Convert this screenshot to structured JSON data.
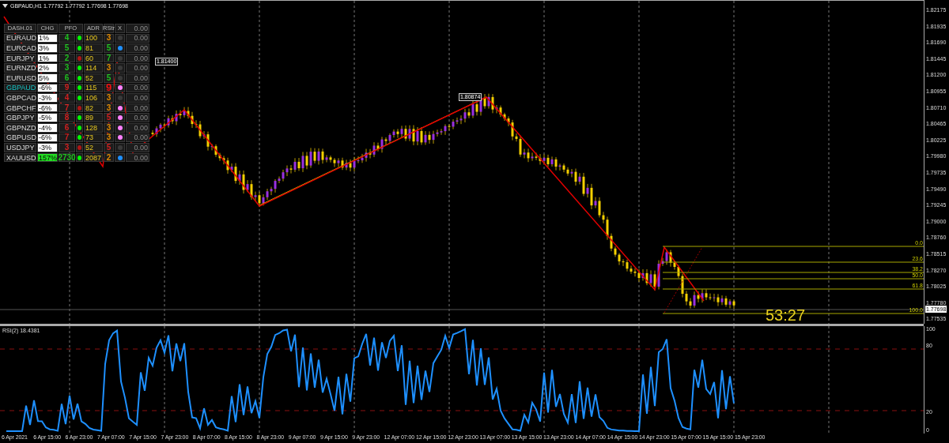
{
  "chart_header": {
    "title": "GBPAUD,H1  1.77792 1.77792 1.77698 1.77698"
  },
  "dashboard": {
    "columns": [
      "DASH.01",
      "CHG",
      "PFO",
      "ADR",
      "RStr",
      "X"
    ],
    "header_value": "0.00",
    "rows": [
      {
        "symbol": "EURAUD",
        "symbol_highlight": false,
        "chg": "1%",
        "chg_highlight": false,
        "pfo": {
          "text": "4",
          "color": "#1fc01f"
        },
        "pfo_dot": {
          "color": "#00ff00"
        },
        "adr": "100",
        "rstr": {
          "text": "3",
          "color": "#e08a00",
          "large": false
        },
        "rstr_dot": {
          "color": "#3a3a3a"
        },
        "value": "0.00"
      },
      {
        "symbol": "EURCAD",
        "symbol_highlight": false,
        "chg": "3%",
        "chg_highlight": false,
        "pfo": {
          "text": "5",
          "color": "#1fc01f"
        },
        "pfo_dot": {
          "color": "#00ff00"
        },
        "adr": "81",
        "rstr": {
          "text": "5",
          "color": "#1fc01f",
          "large": false
        },
        "rstr_dot": {
          "color": "#1e90ff"
        },
        "value": "0.00"
      },
      {
        "symbol": "EURJPY",
        "symbol_highlight": false,
        "chg": "1%",
        "chg_highlight": false,
        "pfo": {
          "text": "2",
          "color": "#1fc01f"
        },
        "pfo_dot": {
          "color": "#b01515"
        },
        "adr": "60",
        "rstr": {
          "text": "7",
          "color": "#1fc01f",
          "large": false
        },
        "rstr_dot": {
          "color": "#3a3a3a"
        },
        "value": "0.00"
      },
      {
        "symbol": "EURNZD",
        "symbol_highlight": false,
        "chg": "2%",
        "chg_highlight": false,
        "pfo": {
          "text": "3",
          "color": "#1fc01f"
        },
        "pfo_dot": {
          "color": "#00ff00"
        },
        "adr": "114",
        "rstr": {
          "text": "3",
          "color": "#e08a00",
          "large": false
        },
        "rstr_dot": {
          "color": "#3a3a3a"
        },
        "value": "0.00"
      },
      {
        "symbol": "EURUSD",
        "symbol_highlight": false,
        "chg": "5%",
        "chg_highlight": false,
        "pfo": {
          "text": "6",
          "color": "#1fc01f"
        },
        "pfo_dot": {
          "color": "#00ff00"
        },
        "adr": "52",
        "rstr": {
          "text": "5",
          "color": "#1fc01f",
          "large": false
        },
        "rstr_dot": {
          "color": "#3a3a3a"
        },
        "value": "0.00"
      },
      {
        "symbol": "GBPAUD",
        "symbol_highlight": true,
        "chg": "-6%",
        "chg_highlight": false,
        "pfo": {
          "text": "9",
          "color": "#d02020"
        },
        "pfo_dot": {
          "color": "#00ff00"
        },
        "adr": "115",
        "rstr": {
          "text": "9",
          "color": "#f01010",
          "large": true
        },
        "rstr_dot": {
          "color": "#ff80ff"
        },
        "value": "0.00"
      },
      {
        "symbol": "GBPCAD",
        "symbol_highlight": false,
        "chg": "-3%",
        "chg_highlight": false,
        "pfo": {
          "text": "4",
          "color": "#d02020"
        },
        "pfo_dot": {
          "color": "#00ff00"
        },
        "adr": "106",
        "rstr": {
          "text": "3",
          "color": "#e08a00",
          "large": false
        },
        "rstr_dot": {
          "color": "#3a3a3a"
        },
        "value": "0.00"
      },
      {
        "symbol": "GBPCHF",
        "symbol_highlight": false,
        "chg": "-6%",
        "chg_highlight": false,
        "pfo": {
          "text": "7",
          "color": "#d02020"
        },
        "pfo_dot": {
          "color": "#b01515"
        },
        "adr": "82",
        "rstr": {
          "text": "3",
          "color": "#e08a00",
          "large": false
        },
        "rstr_dot": {
          "color": "#ff80ff"
        },
        "value": "0.00"
      },
      {
        "symbol": "GBPJPY",
        "symbol_highlight": false,
        "chg": "-5%",
        "chg_highlight": false,
        "pfo": {
          "text": "8",
          "color": "#d02020"
        },
        "pfo_dot": {
          "color": "#00ff00"
        },
        "adr": "89",
        "rstr": {
          "text": "5",
          "color": "#d02020",
          "large": false
        },
        "rstr_dot": {
          "color": "#ff80ff"
        },
        "value": "0.00"
      },
      {
        "symbol": "GBPNZD",
        "symbol_highlight": false,
        "chg": "-4%",
        "chg_highlight": false,
        "pfo": {
          "text": "6",
          "color": "#d02020"
        },
        "pfo_dot": {
          "color": "#00ff00"
        },
        "adr": "128",
        "rstr": {
          "text": "3",
          "color": "#e08a00",
          "large": false
        },
        "rstr_dot": {
          "color": "#ff80ff"
        },
        "value": "0.00"
      },
      {
        "symbol": "GBPUSD",
        "symbol_highlight": false,
        "chg": "-6%",
        "chg_highlight": false,
        "pfo": {
          "text": "7",
          "color": "#d02020"
        },
        "pfo_dot": {
          "color": "#00ff00"
        },
        "adr": "73",
        "rstr": {
          "text": "3",
          "color": "#e08a00",
          "large": false
        },
        "rstr_dot": {
          "color": "#ff80ff"
        },
        "value": "0.00"
      },
      {
        "symbol": "USDJPY",
        "symbol_highlight": false,
        "chg": "-3%",
        "chg_highlight": false,
        "pfo": {
          "text": "3",
          "color": "#d02020"
        },
        "pfo_dot": {
          "color": "#b01515"
        },
        "adr": "52",
        "rstr": {
          "text": "5",
          "color": "#d02020",
          "large": false
        },
        "rstr_dot": {
          "color": "#3a3a3a"
        },
        "value": "0.00"
      },
      {
        "symbol": "XAUUSD",
        "symbol_highlight": false,
        "chg": "157%",
        "chg_highlight": true,
        "pfo": {
          "text": "2730",
          "color": "#1fc01f"
        },
        "pfo_dot": {
          "color": "#00ff00"
        },
        "adr": "2087",
        "rstr": {
          "text": "2",
          "color": "#e08a00",
          "large": false
        },
        "rstr_dot": {
          "color": "#1e90ff"
        },
        "value": "0.00"
      }
    ]
  },
  "price_tags": [
    "1.81400",
    "1.80874"
  ],
  "fibonacci_levels": [
    "0.0",
    "23.6",
    "38.2",
    "50.0",
    "61.8",
    "100.0"
  ],
  "countdown": "53:27",
  "price_axis": {
    "labels": [
      "1.82175",
      "1.81935",
      "1.81690",
      "1.81445",
      "1.81200",
      "1.80955",
      "1.80710",
      "1.80465",
      "1.80225",
      "1.79980",
      "1.79735",
      "1.79490",
      "1.79245",
      "1.79000",
      "1.78760",
      "1.78515",
      "1.78270",
      "1.78025",
      "1.77780",
      "1.77535"
    ],
    "current_price": "1.77698"
  },
  "rsi": {
    "title": "RSI(2) 18.4381",
    "axis_labels": [
      "100",
      "80",
      "20",
      "0"
    ]
  },
  "time_axis": [
    "6 Apr 2021",
    "6 Apr 15:00",
    "6 Apr 23:00",
    "7 Apr 07:00",
    "7 Apr 15:00",
    "7 Apr 23:00",
    "8 Apr 07:00",
    "8 Apr 15:00",
    "8 Apr 23:00",
    "9 Apr 07:00",
    "9 Apr 15:00",
    "9 Apr 23:00",
    "12 Apr 07:00",
    "12 Apr 15:00",
    "12 Apr 23:00",
    "13 Apr 07:00",
    "13 Apr 15:00",
    "13 Apr 23:00",
    "14 Apr 07:00",
    "14 Apr 15:00",
    "14 Apr 23:00",
    "15 Apr 07:00",
    "15 Apr 15:00",
    "15 Apr 23:00"
  ]
}
